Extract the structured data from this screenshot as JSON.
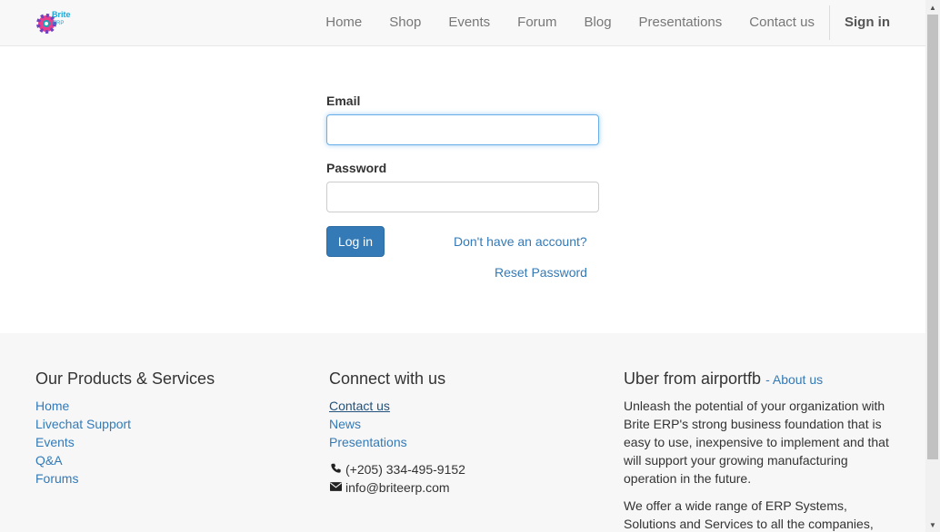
{
  "brand": {
    "name": "Brite ERP",
    "logo_text": "Brite"
  },
  "nav": {
    "items": [
      "Home",
      "Shop",
      "Events",
      "Forum",
      "Blog",
      "Presentations",
      "Contact us"
    ],
    "signin": "Sign in"
  },
  "login": {
    "email_label": "Email",
    "email_value": "",
    "password_label": "Password",
    "password_value": "",
    "login_button": "Log in",
    "signup_link": "Don't have an account?",
    "reset_link": "Reset Password"
  },
  "footer": {
    "products": {
      "title": "Our Products & Services",
      "links": [
        "Home",
        "Livechat Support",
        "Events",
        "Q&A",
        "Forums"
      ]
    },
    "connect": {
      "title": "Connect with us",
      "links": [
        "Contact us",
        "News",
        "Presentations"
      ],
      "phone": "(+205) 334-495-9152",
      "email": "info@briteerp.com"
    },
    "about": {
      "title": "Uber from airportfb",
      "about_link": "- About us",
      "para1": "Unleash the potential of your organization with Brite ERP's strong business foundation that is easy to use, inexpensive to implement and that will support your growing manufacturing operation in the future.",
      "para2": "We offer a wide range of ERP Systems, Solutions and Services to all the companies,"
    }
  },
  "icons": {
    "phone": "phone-icon",
    "envelope": "envelope-icon"
  },
  "colors": {
    "link": "#337ab7",
    "button": "#337ab7",
    "footer_bg": "#f7f7f7",
    "navbar_bg": "#f8f8f8"
  }
}
